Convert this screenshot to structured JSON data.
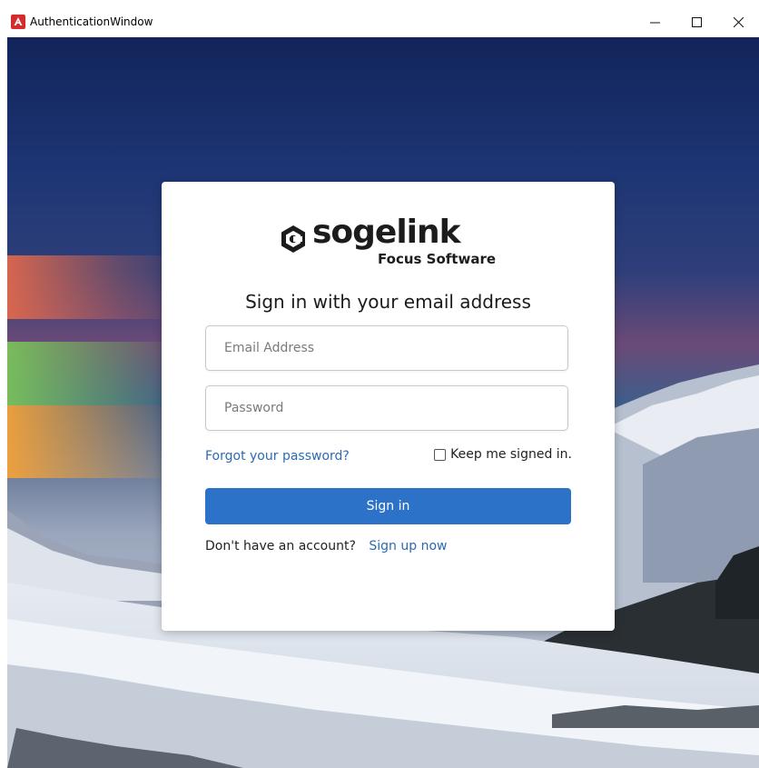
{
  "window": {
    "title": "AuthenticationWindow",
    "app_icon": "app-logo-icon",
    "controls": {
      "minimize": "minimize-icon",
      "maximize": "maximize-icon",
      "close": "close-icon"
    }
  },
  "brand": {
    "name": "sogelink",
    "subtitle": "Focus Software",
    "color": "#1c1c1c"
  },
  "form": {
    "heading": "Sign in with your email address",
    "email_placeholder": "Email Address",
    "password_placeholder": "Password",
    "forgot_label": "Forgot your password?",
    "keep_signed_in_label": "Keep me signed in.",
    "keep_signed_in_checked": false,
    "signin_label": "Sign in",
    "no_account_text": "Don't have an account?",
    "signup_label": "Sign up now"
  },
  "colors": {
    "accent": "#2b72c8",
    "link": "#2a6bb4"
  }
}
